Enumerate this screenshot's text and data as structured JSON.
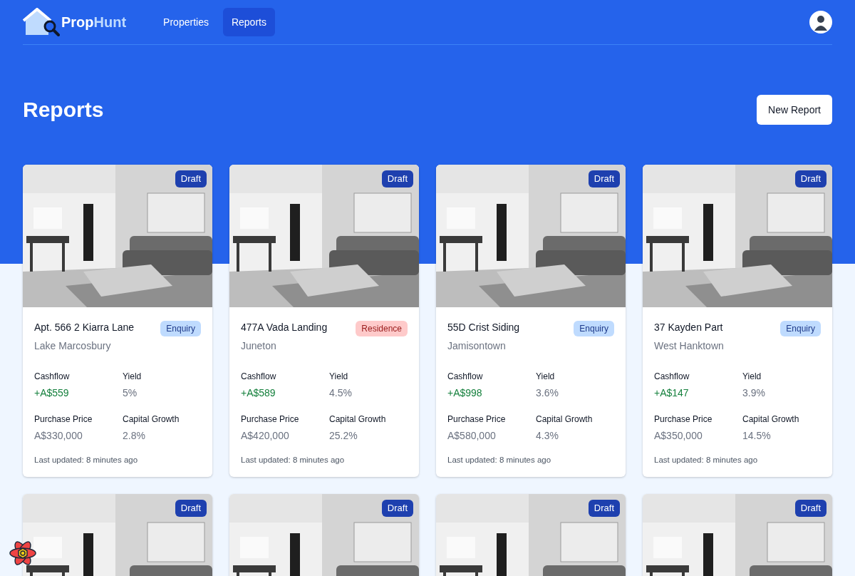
{
  "brand": {
    "first": "Prop",
    "second": "Hunt"
  },
  "nav": [
    {
      "label": "Properties",
      "selected": false
    },
    {
      "label": "Reports",
      "selected": true
    }
  ],
  "title": "Reports",
  "new_button": "New Report",
  "cards": [
    {
      "status": "Draft",
      "address": "Apt. 566 2 Kiarra Lane",
      "suburb": "Lake Marcosbury",
      "tag": {
        "label": "Enquiry",
        "kind": "enquiry"
      },
      "stats": [
        {
          "label": "Cashflow",
          "value": "+A$559",
          "kind": "positive"
        },
        {
          "label": "Yield",
          "value": "5%",
          "kind": "plain"
        },
        {
          "label": "Purchase Price",
          "value": "A$330,000",
          "kind": "plain"
        },
        {
          "label": "Capital Growth",
          "value": "2.8%",
          "kind": "plain"
        }
      ],
      "updated": "Last updated: 8 minutes ago"
    },
    {
      "status": "Draft",
      "address": "477A Vada Landing",
      "suburb": "Juneton",
      "tag": {
        "label": "Residence",
        "kind": "residence"
      },
      "stats": [
        {
          "label": "Cashflow",
          "value": "+A$589",
          "kind": "positive"
        },
        {
          "label": "Yield",
          "value": "4.5%",
          "kind": "plain"
        },
        {
          "label": "Purchase Price",
          "value": "A$420,000",
          "kind": "plain"
        },
        {
          "label": "Capital Growth",
          "value": "25.2%",
          "kind": "plain"
        }
      ],
      "updated": "Last updated: 8 minutes ago"
    },
    {
      "status": "Draft",
      "address": "55D Crist Siding",
      "suburb": "Jamisontown",
      "tag": {
        "label": "Enquiry",
        "kind": "enquiry"
      },
      "stats": [
        {
          "label": "Cashflow",
          "value": "+A$998",
          "kind": "positive"
        },
        {
          "label": "Yield",
          "value": "3.6%",
          "kind": "plain"
        },
        {
          "label": "Purchase Price",
          "value": "A$580,000",
          "kind": "plain"
        },
        {
          "label": "Capital Growth",
          "value": "4.3%",
          "kind": "plain"
        }
      ],
      "updated": "Last updated: 8 minutes ago"
    },
    {
      "status": "Draft",
      "address": "37 Kayden Part",
      "suburb": "West Hanktown",
      "tag": {
        "label": "Enquiry",
        "kind": "enquiry"
      },
      "stats": [
        {
          "label": "Cashflow",
          "value": "+A$147",
          "kind": "positive"
        },
        {
          "label": "Yield",
          "value": "3.9%",
          "kind": "plain"
        },
        {
          "label": "Purchase Price",
          "value": "A$350,000",
          "kind": "plain"
        },
        {
          "label": "Capital Growth",
          "value": "14.5%",
          "kind": "plain"
        }
      ],
      "updated": "Last updated: 8 minutes ago"
    },
    {
      "status": "Draft"
    },
    {
      "status": "Draft"
    },
    {
      "status": "Draft"
    },
    {
      "status": "Draft"
    }
  ]
}
